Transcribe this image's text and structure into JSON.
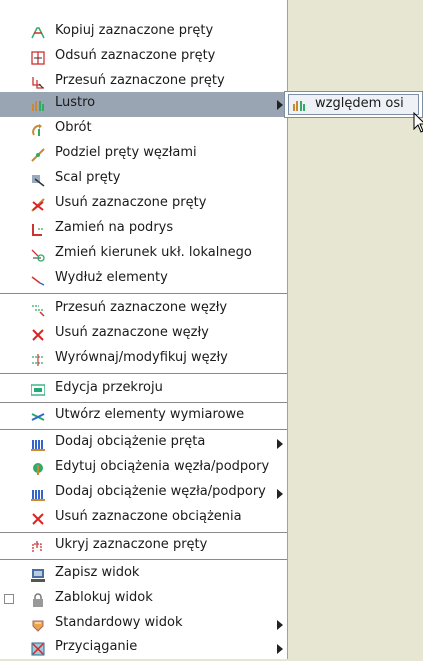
{
  "menu": {
    "items": [
      {
        "label": "Kopiuj zaznaczone pręty",
        "icon": "copy-bars-icon"
      },
      {
        "label": "Odsuń zaznaczone pręty",
        "icon": "offset-bars-icon"
      },
      {
        "label": "Przesuń zaznaczone pręty",
        "icon": "move-bars-icon"
      },
      {
        "label": "Lustro",
        "icon": "mirror-icon",
        "submenu": true,
        "highlighted": true
      },
      {
        "label": "Obrót",
        "icon": "rotate-icon"
      },
      {
        "label": "Podziel pręty węzłami",
        "icon": "split-bars-icon"
      },
      {
        "label": "Scal pręty",
        "icon": "merge-bars-icon"
      },
      {
        "label": "Usuń zaznaczone pręty",
        "icon": "delete-bars-icon"
      },
      {
        "label": "Zamień na podrys",
        "icon": "convert-to-underlay-icon"
      },
      {
        "label": "Zmień kierunek ukł. lokalnego",
        "icon": "change-local-direction-icon"
      },
      {
        "label": "Wydłuż elementy",
        "icon": "extend-elements-icon"
      },
      {
        "label": "Przesuń zaznaczone węzły",
        "icon": "move-nodes-icon"
      },
      {
        "label": "Usuń zaznaczone węzły",
        "icon": "delete-nodes-icon"
      },
      {
        "label": "Wyrównaj/modyfikuj węzły",
        "icon": "align-nodes-icon"
      },
      {
        "label": "Edycja przekroju",
        "icon": "section-edit-icon"
      },
      {
        "label": "Utwórz elementy wymiarowe",
        "icon": "dimension-elements-icon"
      },
      {
        "label": "Dodaj obciążenie pręta",
        "icon": "bar-load-icon",
        "submenu": true
      },
      {
        "label": "Edytuj obciążenia węzła/podpory",
        "icon": "edit-node-load-icon"
      },
      {
        "label": "Dodaj obciążenie węzła/podpory",
        "icon": "node-load-icon",
        "submenu": true
      },
      {
        "label": "Usuń zaznaczone obciążenia",
        "icon": "delete-loads-icon"
      },
      {
        "label": "Ukryj zaznaczone pręty",
        "icon": "hide-bars-icon"
      },
      {
        "label": "Zapisz widok",
        "icon": "save-view-icon"
      },
      {
        "label": "Zablokuj widok",
        "icon": "lock-view-icon",
        "checkbox": true
      },
      {
        "label": "Standardowy widok",
        "icon": "standard-view-icon",
        "submenu": true
      },
      {
        "label": "Przyciąganie",
        "icon": "snapping-icon",
        "submenu": true
      }
    ]
  },
  "submenu": {
    "label": "względem osi",
    "icon": "mirror-axis-icon"
  },
  "colors": {
    "background": "#e6e6d2",
    "highlight": "#9aa5b3",
    "separator": "#8a8a8a"
  }
}
